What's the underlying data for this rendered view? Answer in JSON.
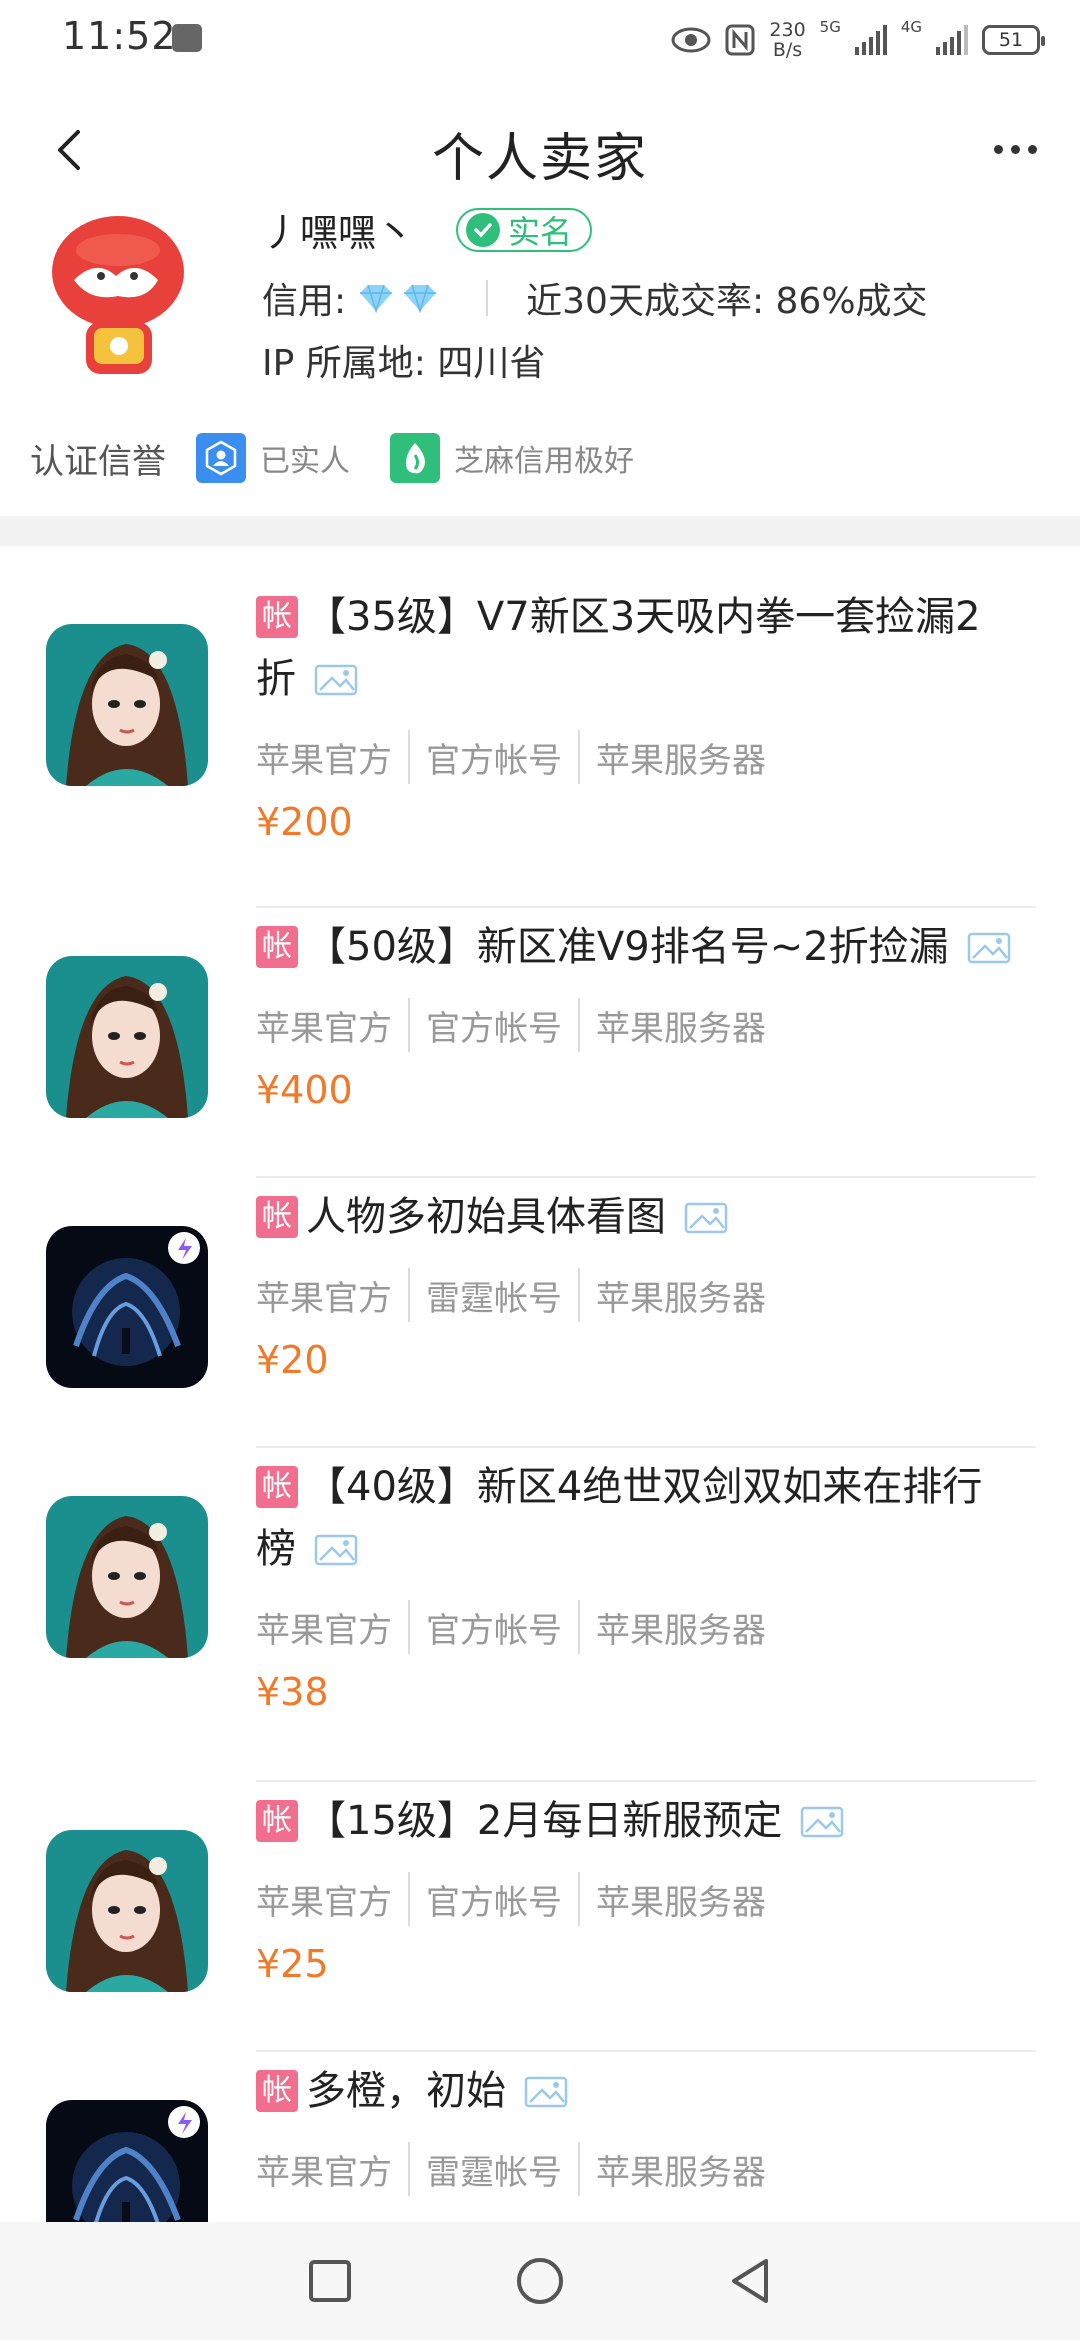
{
  "status_bar": {
    "time": "11:52",
    "net_speed_top": "230",
    "net_speed_bottom": "B/s",
    "sig1_gen": "5G",
    "sig2_gen": "4G",
    "battery": "51"
  },
  "header": {
    "title": "个人卖家"
  },
  "seller": {
    "nickname": "丿嘿嘿丶",
    "verified_badge": "实名",
    "credit_label": "信用:",
    "deal_rate": "近30天成交率: 86%成交",
    "ip": "IP 所属地: 四川省"
  },
  "certification": {
    "label": "认证信誉",
    "items": [
      {
        "text": "已实人",
        "color": "#3a8ef0"
      },
      {
        "text": "芝麻信用极好",
        "color": "#2fbf7a"
      }
    ]
  },
  "listings": [
    {
      "tag": "帐",
      "title_line1": "【35级】V7新区3天吸内拳一套捡漏2",
      "title_line2": "折",
      "meta": [
        "苹果官方",
        "官方帐号",
        "苹果服务器"
      ],
      "price": "¥200",
      "icon": "character-game-icon"
    },
    {
      "tag": "帐",
      "title_line1": "【50级】新区准V9排名号~2折捡漏",
      "title_line2": "",
      "meta": [
        "苹果官方",
        "官方帐号",
        "苹果服务器"
      ],
      "price": "¥400",
      "icon": "character-game-icon"
    },
    {
      "tag": "帐",
      "title_line1": "人物多初始具体看图",
      "title_line2": "",
      "meta": [
        "苹果官方",
        "雷霆帐号",
        "苹果服务器"
      ],
      "price": "¥20",
      "icon": "dark-game-icon"
    },
    {
      "tag": "帐",
      "title_line1": "【40级】新区4绝世双剑双如来在排行",
      "title_line2": "榜",
      "meta": [
        "苹果官方",
        "官方帐号",
        "苹果服务器"
      ],
      "price": "¥38",
      "icon": "character-game-icon"
    },
    {
      "tag": "帐",
      "title_line1": "【15级】2月每日新服预定",
      "title_line2": "",
      "meta": [
        "苹果官方",
        "官方帐号",
        "苹果服务器"
      ],
      "price": "¥25",
      "icon": "character-game-icon"
    },
    {
      "tag": "帐",
      "title_line1": "多橙，初始",
      "title_line2": "",
      "meta": [
        "苹果官方",
        "雷霆帐号",
        "苹果服务器"
      ],
      "price": "",
      "icon": "dark-game-icon"
    }
  ],
  "colors": {
    "accent_price": "#f07a2a",
    "tag_pink": "#f26e8f",
    "verified_green": "#2fbf7a"
  }
}
